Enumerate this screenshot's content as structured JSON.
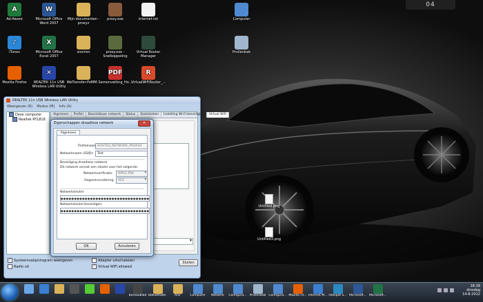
{
  "desktop": {
    "clock_gadget": "04",
    "icons": [
      {
        "label": "Ad-Aware",
        "color": "#1f7a3c",
        "glyph": "A"
      },
      {
        "label": "Microsoft Office Word 2007",
        "color": "#2b5797",
        "glyph": "W"
      },
      {
        "label": "Mijn documenten - proxyz",
        "color": "#d9b25a",
        "glyph": ""
      },
      {
        "label": "proxy.exe",
        "color": "#8a5a3c",
        "glyph": ""
      },
      {
        "label": "Internet.txt",
        "color": "#f2f2f2",
        "glyph": ""
      },
      {
        "label": "Computer",
        "color": "#4f8ad1",
        "glyph": ""
      },
      {
        "label": "iTunes",
        "color": "#2a86d8",
        "glyph": "♪"
      },
      {
        "label": "Microsoft Office Excel 2007",
        "color": "#217346",
        "glyph": "X"
      },
      {
        "label": "snorren",
        "color": "#d9b25a",
        "glyph": ""
      },
      {
        "label": "proxy.exe - Snelkoppeling",
        "color": "#5a6a3c",
        "glyph": ""
      },
      {
        "label": "Virtual Router Manager",
        "color": "#2d4a3a",
        "glyph": ""
      },
      {
        "label": "Prullenbak",
        "color": "#9fb6cc",
        "glyph": ""
      },
      {
        "label": "Mozilla Firefox",
        "color": "#e66000",
        "glyph": ""
      },
      {
        "label": "REALTEK 11n USB Wireless LAN Utility",
        "color": "#2846a8",
        "glyph": "✕"
      },
      {
        "label": "WeTransfer-PoMM...",
        "color": "#d9b25a",
        "glyph": ""
      },
      {
        "label": "Samenvatting_Ho...",
        "color": "#c9302c",
        "glyph": "PDF"
      },
      {
        "label": "VirtualWiFiRouter_...",
        "color": "#d94a2b",
        "glyph": "R"
      }
    ],
    "files": [
      "Untitled.png",
      "Untitled3.png"
    ]
  },
  "realtek": {
    "title": "REALTEK 11n USB Wireless LAN Utility",
    "menu": [
      "Weergeven (R)",
      "Modus (M)",
      "Info (A)"
    ],
    "tree": [
      "Deze computer",
      "Realtek RTL818"
    ],
    "tabs": [
      "Algemeen",
      "Profiel",
      "Beschikbaar netwerk",
      "Status",
      "Statistieken",
      "Instelling Wi-Fi-beveiliging",
      "Virtual WiFi"
    ],
    "options": {
      "systray": "Systeemvakpictogram weergeven",
      "radio_off": "Radio uit",
      "adapter_off": "Adapter uitschakelen",
      "vwifi": "Virtual WiFi allowed"
    },
    "close_label": "Sluiten"
  },
  "dialog": {
    "title": "Eigenschappen draadloos netwerk",
    "tab": "Algemeen",
    "profile_label": "Profielnaam:",
    "profile_value": "HOSTED_NETWORK_PROFILE",
    "ssid_label": "Netwerknaam (SSID):",
    "ssid_value": "Test",
    "security_heading": "Beveiliging draadloos netwerk",
    "security_hint": "Dit netwerk vereist een sleutel voor het volgende:",
    "auth_label": "Netwerkverificatie:",
    "auth_value": "WPA2-PSK",
    "enc_label": "Gegevenscodering:",
    "enc_value": "AES",
    "key_label": "Netwerksleutel:",
    "key_value": "●●●●●●●●●●●●●●●●●●●●●●●●●●●●●●●●●●●●●●●●●●●●●●●●●●●●●",
    "confirm_label": "Netwerksleutel bevestigen:",
    "confirm_value": "●●●●●●●●●●●●●●●●●●●●●●●●●●●●●●●●●●●●●●●●●●●●●●●●●●●●●",
    "ok": "OK",
    "cancel": "Annuleren"
  },
  "taskbar": {
    "items": [
      {
        "label": "",
        "color": "#6aa7e8"
      },
      {
        "label": "",
        "color": "#3a7fd0"
      },
      {
        "label": "",
        "color": "#d9b25a"
      },
      {
        "label": "",
        "color": "#555"
      },
      {
        "label": "",
        "color": "#5c3"
      },
      {
        "label": "",
        "color": "#e66000"
      },
      {
        "label": "",
        "color": "#2846a8"
      },
      {
        "label": "Bureaublad",
        "color": "#444"
      },
      {
        "label": "Bibliotheke...",
        "color": "#d9b25a"
      },
      {
        "label": "Anir",
        "color": "#d9b25a"
      },
      {
        "label": "Computer",
        "color": "#4f8ad1"
      },
      {
        "label": "Netwerk",
        "color": "#4f8ad1"
      },
      {
        "label": "Configura...",
        "color": "#4f8ad1"
      },
      {
        "label": "Prullenbak",
        "color": "#9fb6cc"
      },
      {
        "label": "Configura...",
        "color": "#4f8ad1"
      },
      {
        "label": "Mozilla Fir...",
        "color": "#e66000"
      },
      {
        "label": "Internet M...",
        "color": "#3a7fd0"
      },
      {
        "label": "Hotspot S...",
        "color": "#2a8ac0"
      },
      {
        "label": "Microsoft...",
        "color": "#2b5797"
      },
      {
        "label": "Microsoft...",
        "color": "#217346"
      }
    ],
    "clock_time": "16:18",
    "clock_day": "dinsdag",
    "clock_date": "14-8-2012"
  }
}
